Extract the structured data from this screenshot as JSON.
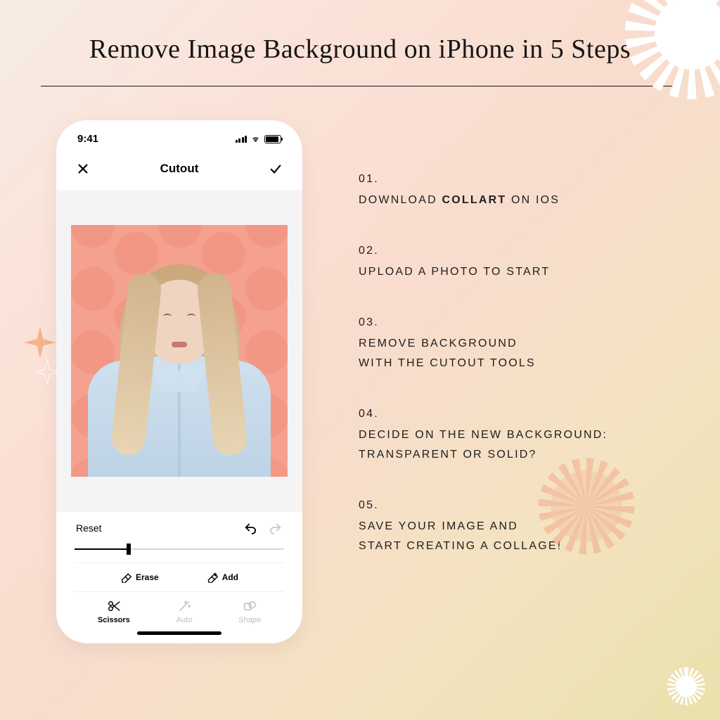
{
  "title": "Remove Image Background on iPhone in 5 Steps",
  "phone": {
    "status_time": "9:41",
    "nav_title": "Cutout",
    "reset_label": "Reset",
    "slider_percent": 26,
    "erase_label": "Erase",
    "add_label": "Add",
    "tabs": {
      "scissors": "Scissors",
      "auto": "Auto",
      "shape": "Shape"
    }
  },
  "steps": [
    {
      "num": "01.",
      "line1": "DOWNLOAD ",
      "strong": "COLLART",
      "line1b": " ON IOS"
    },
    {
      "num": "02.",
      "line1": "UPLOAD A PHOTO TO START"
    },
    {
      "num": "03.",
      "line1": "REMOVE BACKGROUND",
      "line2": "WITH THE CUTOUT TOOLS"
    },
    {
      "num": "04.",
      "line1": "DECIDE ON THE NEW BACKGROUND:",
      "line2": "TRANSPARENT OR SOLID?"
    },
    {
      "num": "05.",
      "line1": "SAVE YOUR IMAGE AND",
      "line2": "START CREATING A COLLAGE!"
    }
  ]
}
